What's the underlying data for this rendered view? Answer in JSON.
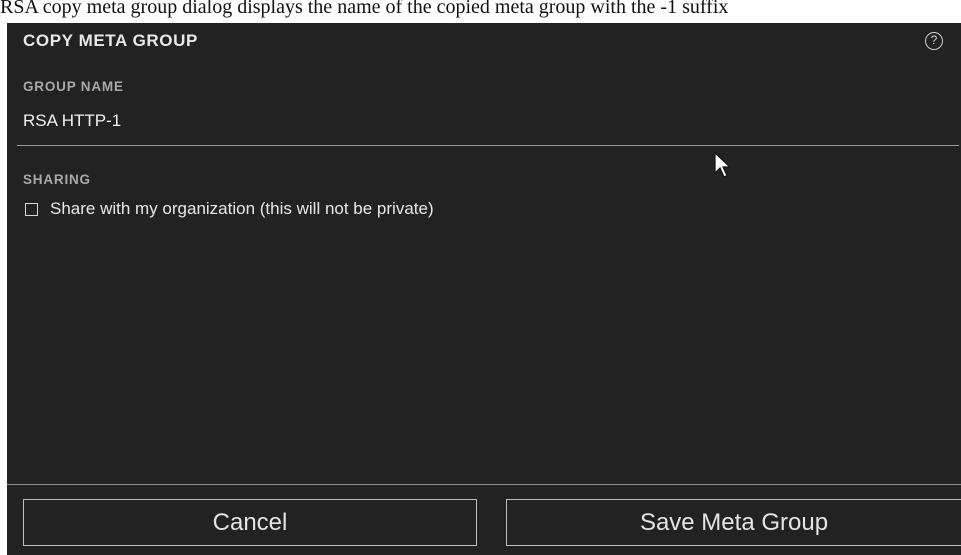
{
  "caption_text": "RSA copy meta group dialog displays the name of the copied meta group with the -1 suffix",
  "dialog": {
    "title": "COPY META GROUP",
    "help_icon": "help-circle-icon",
    "help_glyph": "?",
    "group_name": {
      "label": "GROUP NAME",
      "value": "RSA HTTP-1"
    },
    "sharing": {
      "label": "SHARING",
      "checkbox_label": "Share with my organization (this will not be private)",
      "checked": false
    },
    "buttons": {
      "cancel": "Cancel",
      "save": "Save Meta Group"
    }
  },
  "colors": {
    "dialog_bg": "#222222",
    "label_gray": "#a9a9a9",
    "text": "#e8e8e8"
  }
}
